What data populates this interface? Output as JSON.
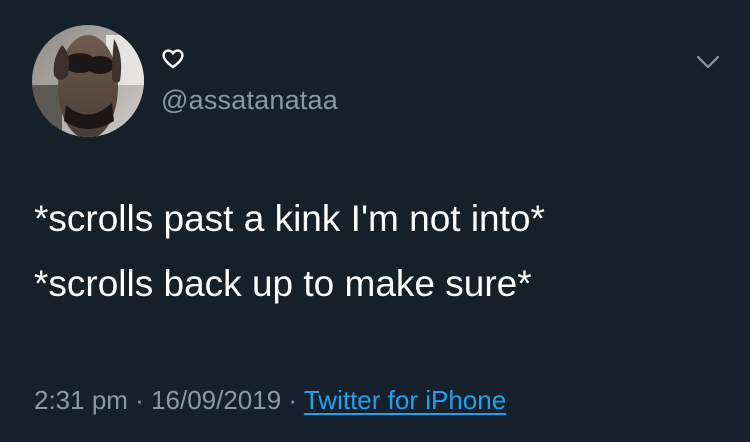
{
  "tweet": {
    "display_name_icon": "heart-outline-icon",
    "handle": "@assatanataa",
    "text_lines": [
      "*scrolls past a kink I'm not into*",
      "*scrolls back up to make sure*"
    ],
    "time": "2:31 pm",
    "separator": " · ",
    "date": "16/09/2019",
    "source": "Twitter for iPhone",
    "menu_icon": "chevron-down-icon"
  },
  "colors": {
    "background": "#15202b",
    "secondary_text": "#8899a6",
    "link": "#1da1f2",
    "primary_text": "#ffffff"
  }
}
